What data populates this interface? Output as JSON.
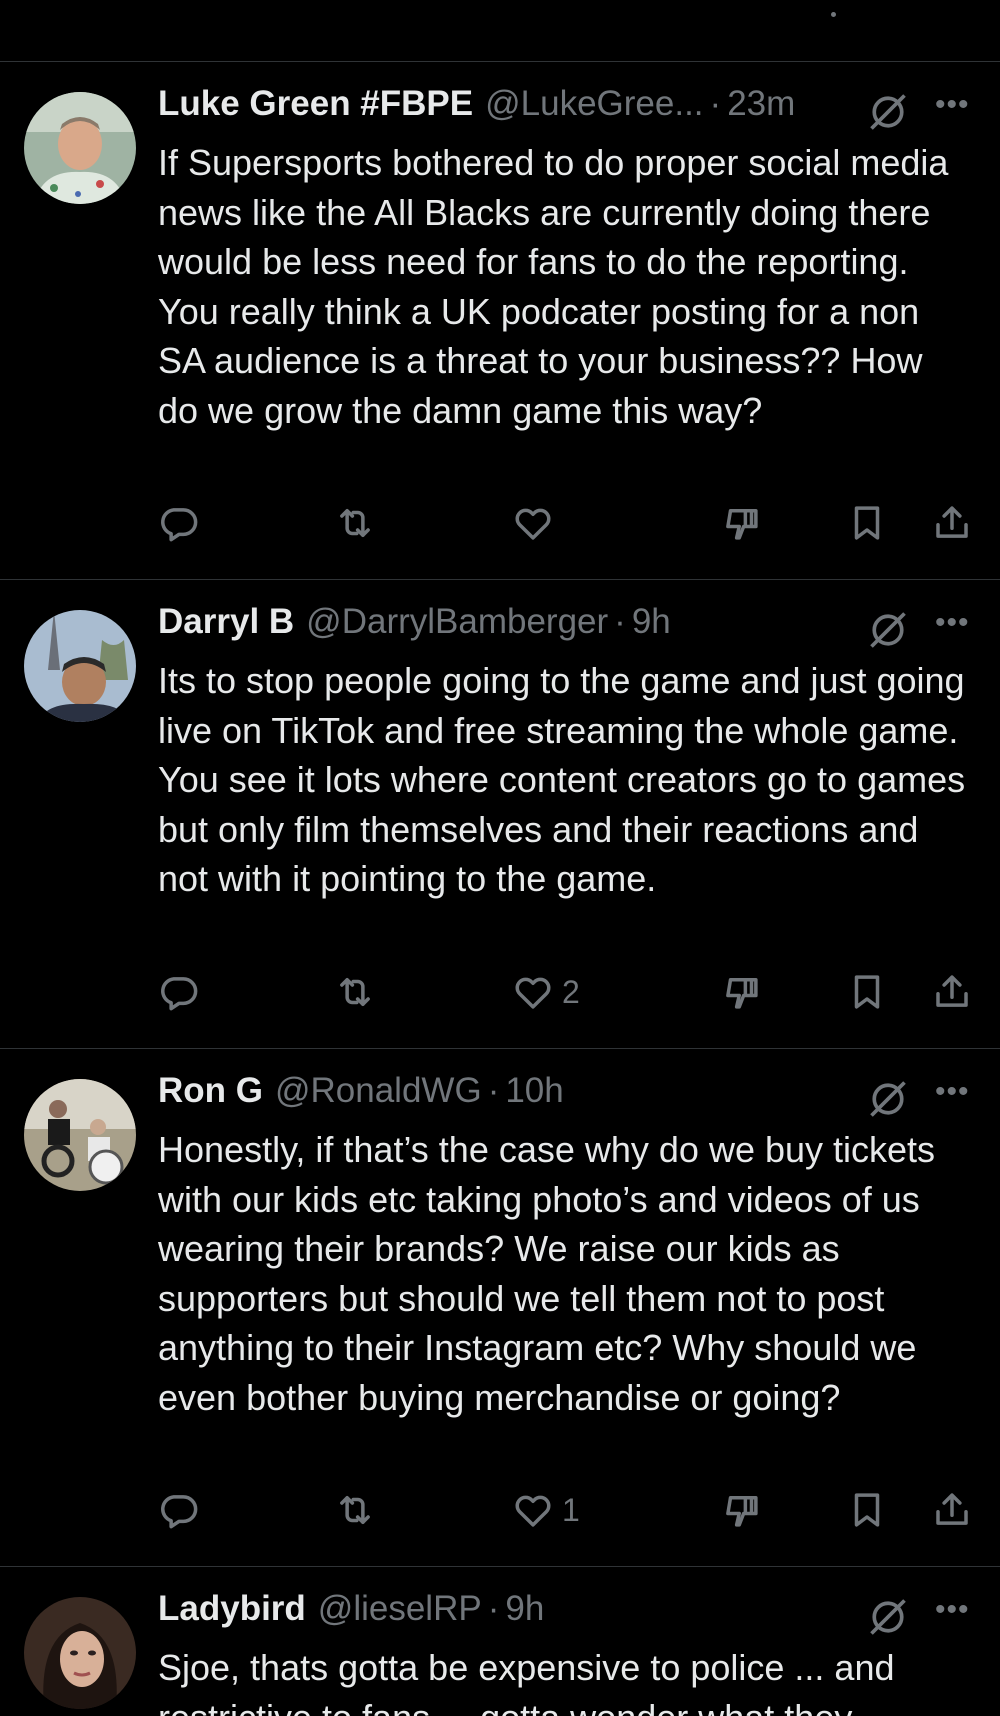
{
  "colors": {
    "background": "#000000",
    "text": "#e7e9ea",
    "muted": "#71767b",
    "divider": "#2f3336"
  },
  "icons": {
    "reply": "reply-icon",
    "retweet": "retweet-icon",
    "like": "heart-icon",
    "dislike": "downvote-icon",
    "bookmark": "bookmark-icon",
    "share": "share-icon",
    "grok": "grok-icon",
    "more": "more-icon"
  },
  "tweets": [
    {
      "name": "Luke Green #FBPE",
      "handle": "@LukeGree...",
      "sep": "·",
      "time": "23m",
      "more": "•••",
      "text": "If Supersports bothered to do proper social media news like the All Blacks are currently doing there would be less need for fans to do the reporting. You really think a UK podcater posting for a non SA audience is a threat to your business?? How do we grow the damn game this way?",
      "like_count": ""
    },
    {
      "name": "Darryl B",
      "handle": "@DarrylBamberger",
      "sep": "·",
      "time": "9h",
      "more": "•••",
      "text": "Its to stop people going to the game and just going live on TikTok and free streaming the whole game. You see it lots where content creators go to games but only film themselves and their reactions and not with it pointing to the game.",
      "like_count": "2"
    },
    {
      "name": "Ron G",
      "handle": "@RonaldWG",
      "sep": "·",
      "time": "10h",
      "more": "•••",
      "text": "Honestly, if that’s the case why do we buy tickets with our kids etc taking photo’s and videos of us wearing their brands? We raise our kids as supporters but should we tell them not to post anything to their Instagram etc? Why should we even bother buying merchandise or going?",
      "like_count": "1"
    },
    {
      "name": "Ladybird",
      "handle": "@lieselRP",
      "sep": "·",
      "time": "9h",
      "more": "•••",
      "text": "Sjoe, thats gotta be expensive to police ... and restrictive to fans.... gotta wonder what they",
      "like_count": ""
    }
  ]
}
